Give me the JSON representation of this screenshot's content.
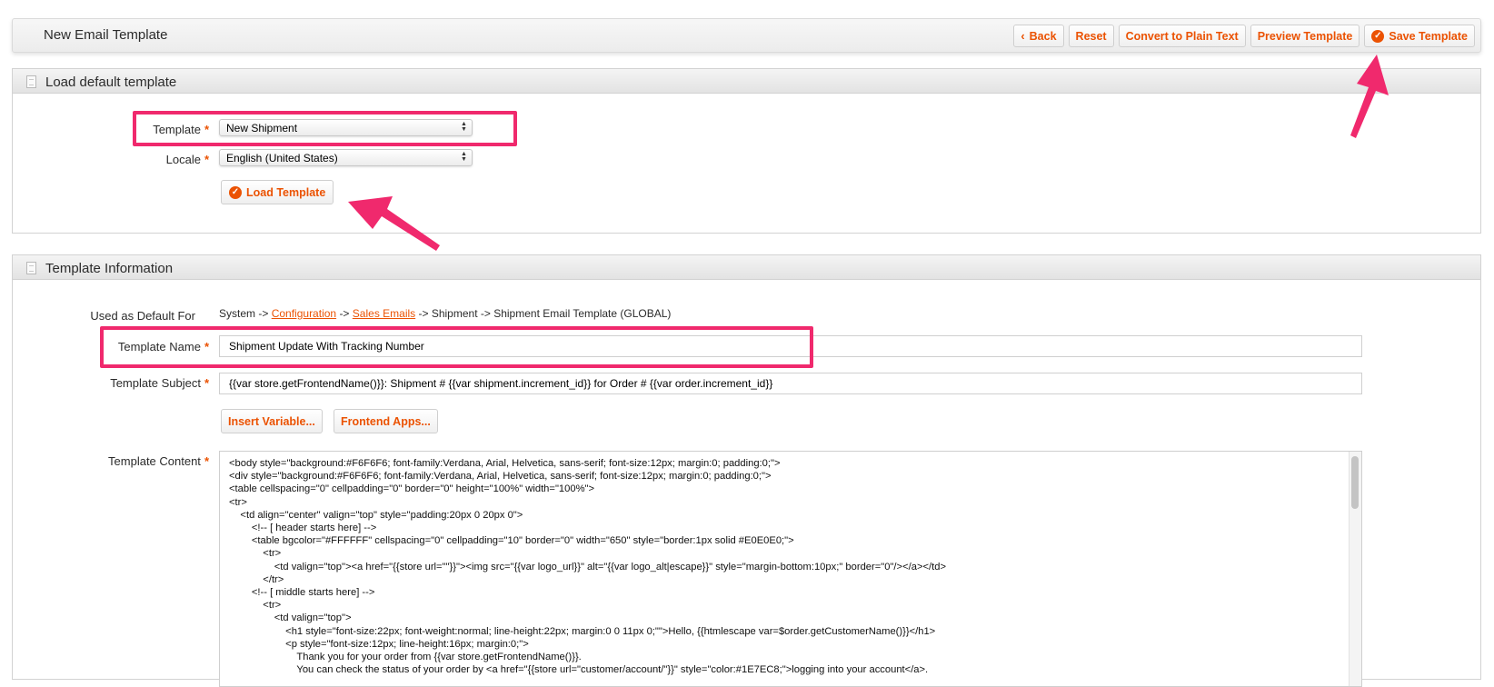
{
  "header": {
    "title": "New Email Template",
    "buttons": {
      "back": "Back",
      "reset": "Reset",
      "convert": "Convert to Plain Text",
      "preview": "Preview Template",
      "save": "Save Template"
    }
  },
  "load_section": {
    "title": "Load default template",
    "template_label": "Template",
    "template_value": "New Shipment",
    "locale_label": "Locale",
    "locale_value": "English (United States)",
    "load_button": "Load Template"
  },
  "info_section": {
    "title": "Template Information",
    "default_for_label": "Used as Default For",
    "breadcrumb": {
      "prefix": "System ->",
      "link1": "Configuration",
      "sep1": "->",
      "link2": "Sales Emails",
      "suffix": "-> Shipment -> Shipment Email Template  (GLOBAL)"
    },
    "name_label": "Template Name",
    "name_value": "Shipment Update With Tracking Number",
    "subject_label": "Template Subject",
    "subject_value": "{{var store.getFrontendName()}}: Shipment # {{var shipment.increment_id}} for Order # {{var order.increment_id}}",
    "insert_variable_button": "Insert Variable...",
    "frontend_apps_button": "Frontend Apps...",
    "content_label": "Template Content",
    "content_lines": [
      "<body style=\"background:#F6F6F6; font-family:Verdana, Arial, Helvetica, sans-serif; font-size:12px; margin:0; padding:0;\">",
      "<div style=\"background:#F6F6F6; font-family:Verdana, Arial, Helvetica, sans-serif; font-size:12px; margin:0; padding:0;\">",
      "<table cellspacing=\"0\" cellpadding=\"0\" border=\"0\" height=\"100%\" width=\"100%\">",
      "<tr>",
      "    <td align=\"center\" valign=\"top\" style=\"padding:20px 0 20px 0\">",
      "        <!-- [ header starts here] -->",
      "        <table bgcolor=\"#FFFFFF\" cellspacing=\"0\" cellpadding=\"10\" border=\"0\" width=\"650\" style=\"border:1px solid #E0E0E0;\">",
      "            <tr>",
      "                <td valign=\"top\"><a href=\"{{store url=\"\"}}\"><img src=\"{{var logo_url}}\" alt=\"{{var logo_alt|escape}}\" style=\"margin-bottom:10px;\" border=\"0\"/></a></td>",
      "            </tr>",
      "        <!-- [ middle starts here] -->",
      "            <tr>",
      "                <td valign=\"top\">",
      "                    <h1 style=\"font-size:22px; font-weight:normal; line-height:22px; margin:0 0 11px 0;\"\">Hello, {{htmlescape var=$order.getCustomerName()}}</h1>",
      "                    <p style=\"font-size:12px; line-height:16px; margin:0;\">",
      "                        Thank you for your order from {{var store.getFrontendName()}}.",
      "                        You can check the status of your order by <a href=\"{{store url=\"customer/account/\"}}\" style=\"color:#1E7EC8;\">logging into your account</a>."
    ]
  }
}
